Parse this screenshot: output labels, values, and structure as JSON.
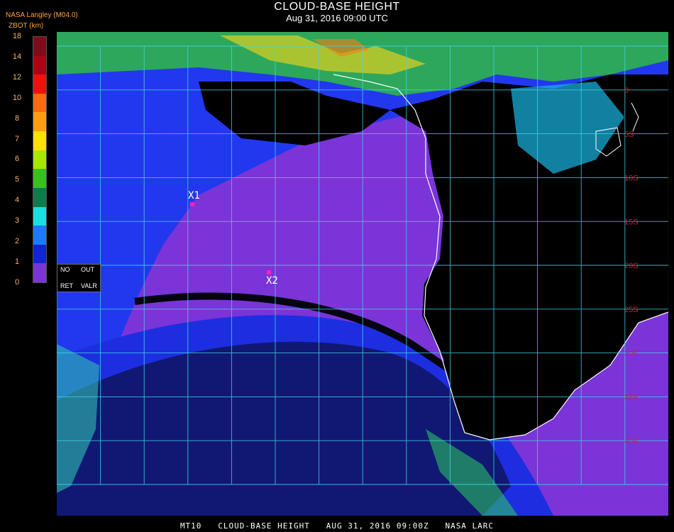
{
  "header": {
    "title": "CLOUD-BASE HEIGHT",
    "datetime": "Aug 31, 2016 09:00 UTC",
    "source": "NASA Langley (M04.0)",
    "param": "ZBOT (km)"
  },
  "colorbar": {
    "ticks": [
      "18",
      "14",
      "12",
      "10",
      "8",
      "7",
      "6",
      "5",
      "4",
      "3",
      "2",
      "1",
      "0"
    ],
    "colors": [
      "#7a0f1a",
      "#b00015",
      "#f01010",
      "#ff6a10",
      "#ff9f10",
      "#ffe000",
      "#a8e800",
      "#3cc01c",
      "#107a4a",
      "#18e0e0",
      "#1e78ff",
      "#1024d8",
      "#7a34d8"
    ]
  },
  "legend": {
    "no": "NO",
    "out": "OUT",
    "ret": "RET",
    "valr": "VALR"
  },
  "map": {
    "colors": {
      "purple": "#7a34d8",
      "blue": "#1e3cff",
      "land": "#000000",
      "grid": "#40d8e8",
      "coast": "#ffffff"
    },
    "lat_labels": [
      "0",
      "5S",
      "10S",
      "15S",
      "20S",
      "25S",
      "30S",
      "35S",
      "40S"
    ],
    "markers": [
      {
        "label": "X1"
      },
      {
        "label": "X2"
      }
    ]
  },
  "footer": "MT10   CLOUD-BASE HEIGHT   AUG 31, 2016 09:00Z   NASA LARC"
}
